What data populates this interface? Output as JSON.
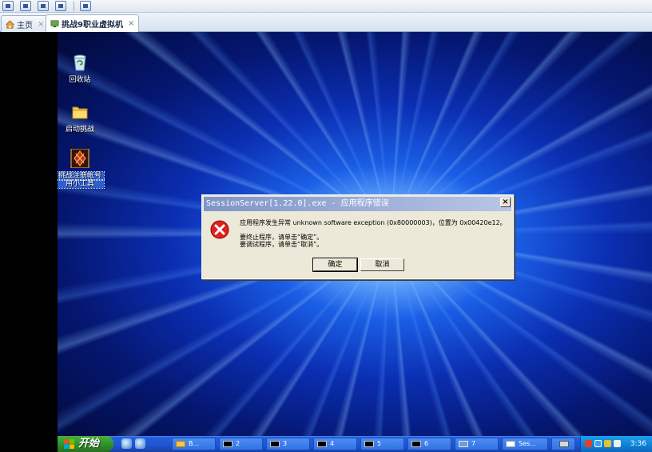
{
  "host_tabs": [
    {
      "label": "主页",
      "close": "×"
    },
    {
      "label": "挑战9职业虚拟机",
      "close": "×"
    }
  ],
  "desktop_icons": [
    {
      "label": "回收站"
    },
    {
      "label": "启动挑战"
    },
    {
      "label_line1": "挑战注册帐号",
      "label_line2": "用小工具"
    }
  ],
  "dialog": {
    "title": "SessionServer[1.22.0].exe - 应用程序错误",
    "close_glyph": "×",
    "message_line1": "应用程序发生异常 unknown software exception (0x80000003)，位置为 0x00420e12。",
    "message_line2": "要终止程序，请单击“确定”。",
    "message_line3": "要调试程序，请单击“取消”。",
    "ok_label": "确定",
    "cancel_label": "取消"
  },
  "taskbar": {
    "start_label": "开始",
    "buttons": [
      {
        "label": "B..."
      },
      {
        "label": "2"
      },
      {
        "label": "3"
      },
      {
        "label": "4"
      },
      {
        "label": "5"
      },
      {
        "label": "6"
      },
      {
        "label": "7"
      },
      {
        "label": "Ses..."
      }
    ],
    "clock": "3:36"
  },
  "colors": {
    "error_red": "#e02020",
    "taskbar_blue": "#245edb",
    "start_green": "#3c9a2f"
  }
}
